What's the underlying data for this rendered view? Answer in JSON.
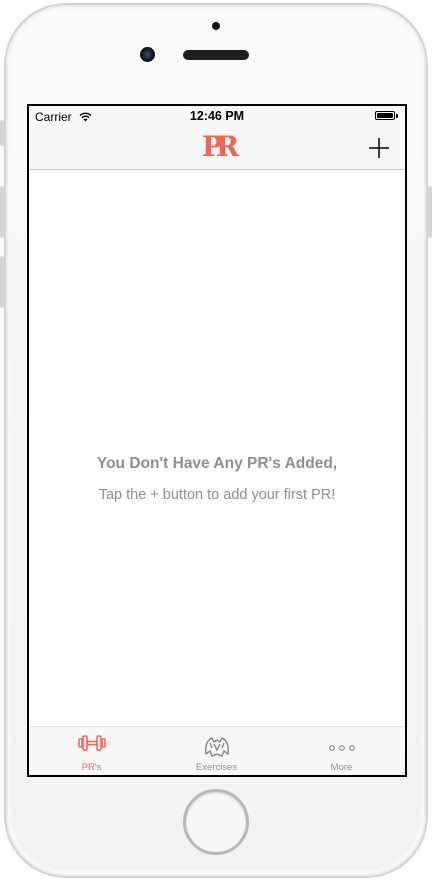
{
  "status_bar": {
    "carrier": "Carrier",
    "time": "12:46 PM"
  },
  "navbar": {
    "logo": "PR",
    "add_icon": "plus-icon"
  },
  "empty_state": {
    "title": "You Don't Have Any PR's Added,",
    "subtitle": "Tap the + button to add your first PR!"
  },
  "tabbar": {
    "tabs": [
      {
        "label": "PR's",
        "icon": "dumbbell-icon",
        "active": true
      },
      {
        "label": "Exercises",
        "icon": "muscle-body-icon",
        "active": false
      },
      {
        "label": "More",
        "icon": "more-dots-icon",
        "active": false
      }
    ]
  },
  "colors": {
    "accent": "#f26553",
    "inactive": "#929292",
    "empty_text": "#8e8e93"
  }
}
